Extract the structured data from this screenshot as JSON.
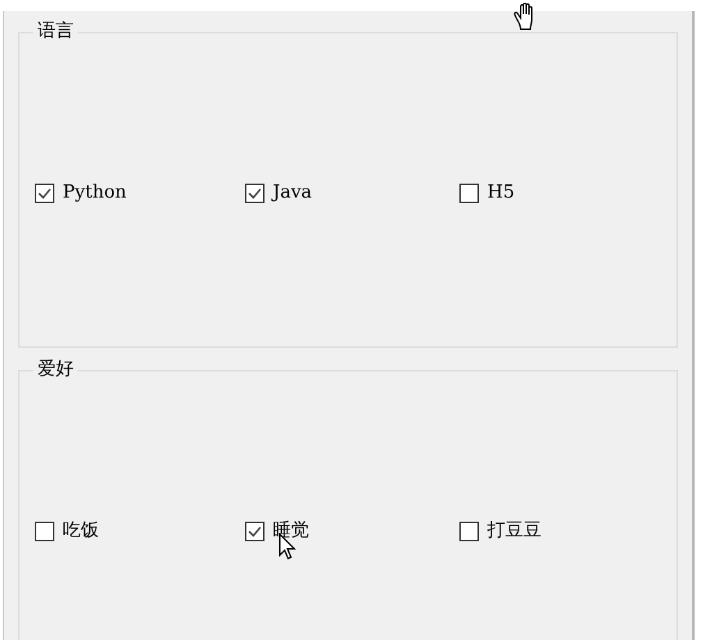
{
  "groups": [
    {
      "title": "语言",
      "options": [
        {
          "label": "Python",
          "checked": true
        },
        {
          "label": "Java",
          "checked": true
        },
        {
          "label": "H5",
          "checked": false
        }
      ]
    },
    {
      "title": "爱好",
      "options": [
        {
          "label": "吃饭",
          "checked": false
        },
        {
          "label": "睡觉",
          "checked": true
        },
        {
          "label": "打豆豆",
          "checked": false
        }
      ]
    }
  ]
}
